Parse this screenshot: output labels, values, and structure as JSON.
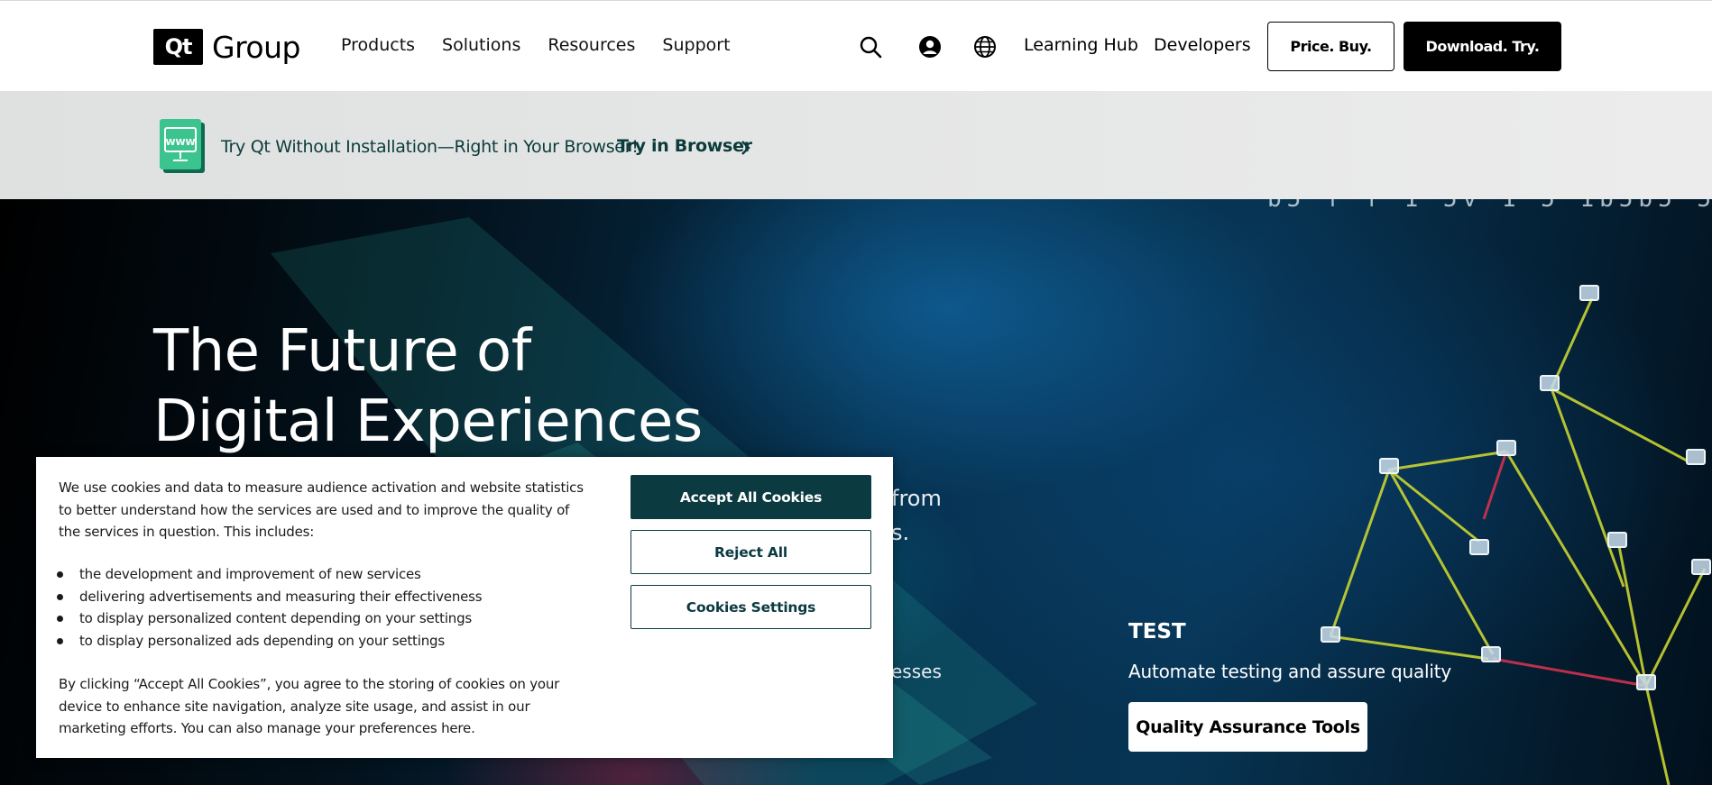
{
  "header": {
    "logo_mark": "Qt",
    "logo_text": "Group",
    "nav": [
      "Products",
      "Solutions",
      "Resources",
      "Support"
    ],
    "icons": [
      "search-icon",
      "account-icon",
      "globe-icon"
    ],
    "learning_hub": "Learning Hub",
    "developers": "Developers",
    "price_buy": "Price. Buy.",
    "download_try": "Download. Try."
  },
  "banner": {
    "icon": "www-browser-icon",
    "icon_label": "WWW",
    "text": "Try Qt Without Installation—Right in Your Browser!",
    "link": "Try in Browser"
  },
  "hero": {
    "title_line1": "The Future of",
    "title_line2": "Digital Experiences",
    "frag1": "from",
    "frag2": "s.",
    "frag3": "esses",
    "test_title": "TEST",
    "test_desc": "Automate testing and assure quality",
    "qa_button": "Quality Assurance Tools"
  },
  "cookie": {
    "intro": "We use cookies and data to measure audience activation and website statistics to better understand how the services are used and to improve the quality of the services in question. This includes:",
    "items": [
      "the development and improvement of new services",
      "delivering advertisements and measuring their effectiveness",
      "to display personalized content depending on your settings",
      "to display personalized ads depending on your settings"
    ],
    "footer": "By clicking “Accept All Cookies”, you agree to the storing of cookies on your device to enhance site navigation, analyze site usage, and assist in our marketing efforts. You can also manage your preferences here.",
    "accept": "Accept All Cookies",
    "reject": "Reject All",
    "settings": "Cookies Settings"
  },
  "colors": {
    "cookie_accent": "#0b3b40",
    "banner_text": "#0b3b3b",
    "hero_bg": "#06304d"
  }
}
